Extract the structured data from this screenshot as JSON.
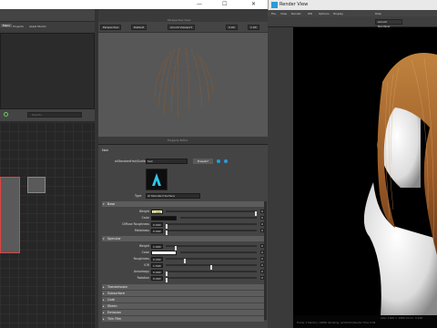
{
  "main_window": {
    "title": "",
    "controls": [
      "—",
      "☐",
      "✕"
    ]
  },
  "outliner": {
    "tabs": [
      "Menu",
      "Projects",
      "Asset Studio"
    ],
    "selected_tab": "Menu"
  },
  "node_editor": {
    "search_placeholder": "Search..."
  },
  "viewport": {
    "panel_title": "Perspective View",
    "camera_label": "Perspective",
    "display_mode": "Default",
    "renderer": "Arnold Viewport",
    "exposure": "0.00",
    "gamma": "1.00"
  },
  "property_editor": {
    "panel_title": "Property Editor",
    "node_type": "Hair",
    "shader_label": "aiStandardHair/Surface",
    "shader_name": "hair",
    "presets_label": "Presets*",
    "type_label": "Type",
    "type_value": "AI Standard Surface",
    "sections": {
      "base": "Base",
      "specular": "Specular",
      "transmission": "Transmission",
      "subsurface": "Subsurface",
      "coat": "Coat",
      "sheen": "Sheen",
      "emission": "Emission",
      "thin_film": "Thin Film"
    },
    "base_rows": [
      {
        "label": "Weight",
        "value": "1.000",
        "highlight": true,
        "fill": 1.0
      },
      {
        "label": "Color",
        "swatch": "#111111"
      },
      {
        "label": "Diffuse Roughness",
        "value": "0.000",
        "fill": 0.0
      },
      {
        "label": "Metalness",
        "value": "0.000",
        "fill": 0.0
      }
    ],
    "specular_rows": [
      {
        "label": "Weight",
        "value": "1.000",
        "fill": 0.1
      },
      {
        "label": "Color",
        "swatch": "#ffffff"
      },
      {
        "label": "Roughness",
        "value": "0.200",
        "fill": 0.2
      },
      {
        "label": "IOR",
        "value": "1.500",
        "fill": 0.5
      },
      {
        "label": "Anisotropy",
        "value": "0.000",
        "fill": 0.0
      },
      {
        "label": "Rotation",
        "value": "0.000",
        "fill": 0.0
      }
    ]
  },
  "render_view": {
    "title": "Render View",
    "menu": [
      "File",
      "View",
      "Render",
      "IPR",
      "Options",
      "Display",
      "Help"
    ],
    "renderer": "Arnold Renderer",
    "status_line1": "size: 1920 x 1080 zoom: 0.200",
    "status_line2": "Frame: 1   Memory: 100Mb   Sampling: [2/2/2/2/2]   Render Time: 0:06"
  }
}
